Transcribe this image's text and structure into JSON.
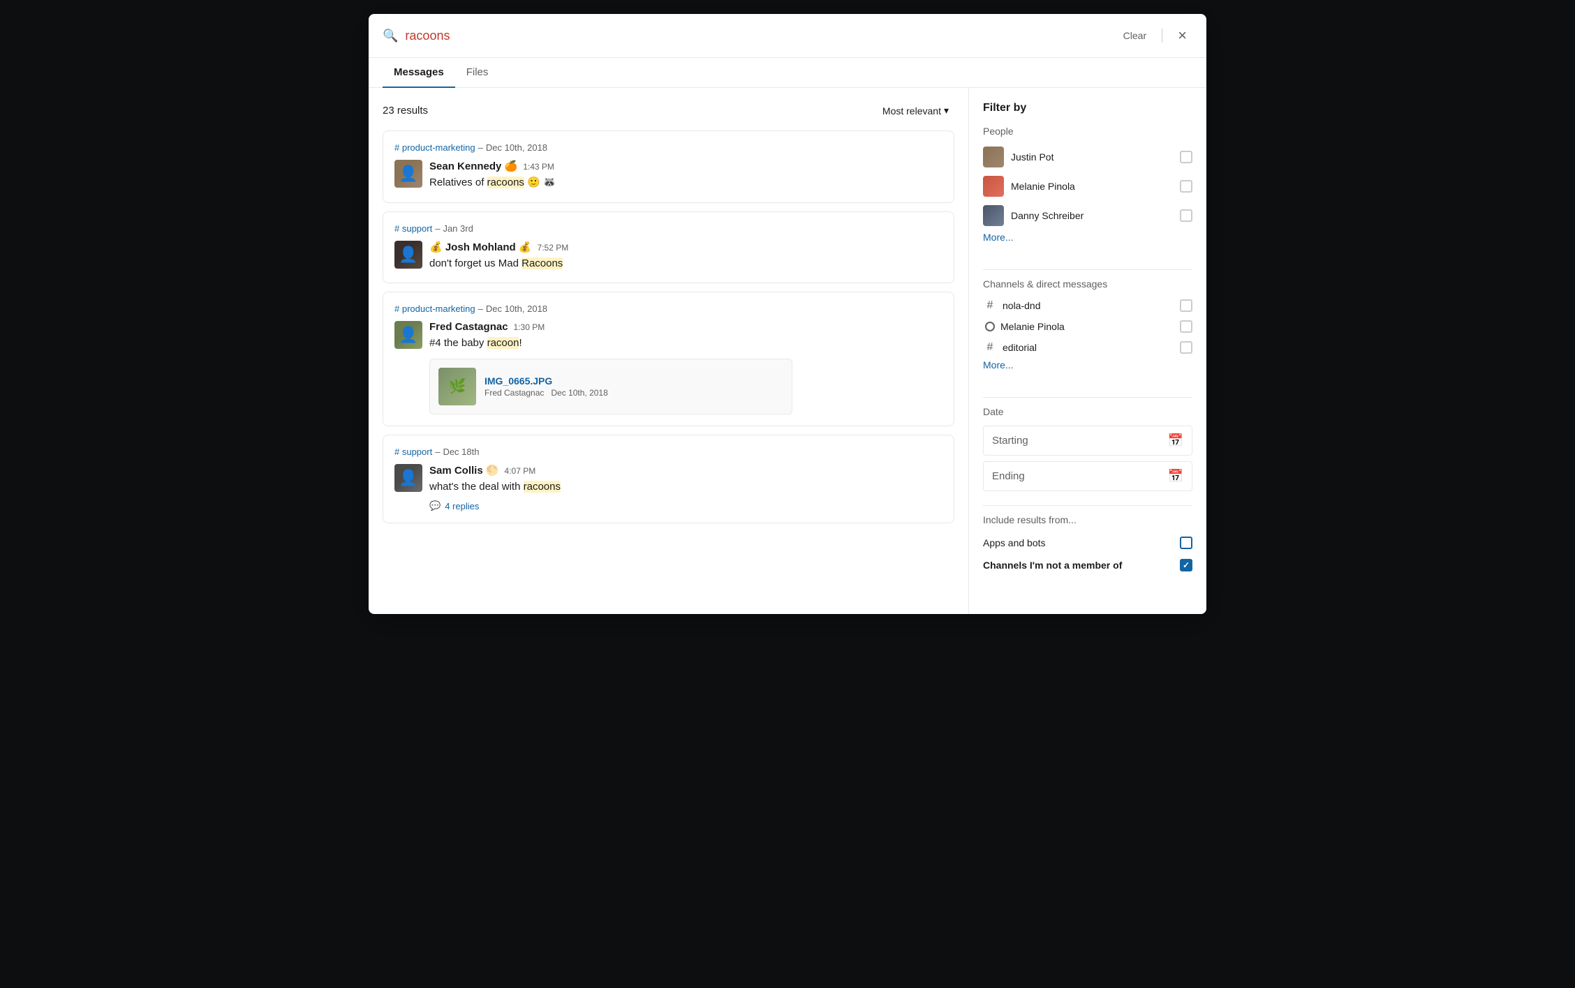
{
  "modal": {
    "search": {
      "query": "racoons",
      "clear_label": "Clear",
      "close_label": "×"
    },
    "tabs": [
      {
        "id": "messages",
        "label": "Messages",
        "active": true
      },
      {
        "id": "files",
        "label": "Files",
        "active": false
      }
    ],
    "results": {
      "count": "23 results",
      "sort_label": "Most relevant",
      "messages": [
        {
          "id": "msg1",
          "channel": "# product-marketing",
          "date": "Dec 10th, 2018",
          "author": "Sean Kennedy",
          "author_emoji": "🍊",
          "time": "1:43 PM",
          "text_parts": [
            {
              "type": "text",
              "content": "Relatives of "
            },
            {
              "type": "highlight",
              "content": "racoons"
            },
            {
              "type": "text",
              "content": " 🙂 🦝"
            }
          ],
          "avatar_class": "avatar-1",
          "avatar_emoji": "👤"
        },
        {
          "id": "msg2",
          "channel": "# support",
          "date": "Jan 3rd",
          "author": "Josh Mohland",
          "author_emoji": "💰",
          "time": "7:52 PM",
          "text_parts": [
            {
              "type": "text",
              "content": "don't forget us Mad "
            },
            {
              "type": "highlight",
              "content": "Racoons"
            }
          ],
          "avatar_class": "avatar-2",
          "avatar_emoji": "👤"
        },
        {
          "id": "msg3",
          "channel": "# product-marketing",
          "date": "Dec 10th, 2018",
          "author": "Fred Castagnac",
          "time": "1:30 PM",
          "text_parts": [
            {
              "type": "text",
              "content": "#4 the baby "
            },
            {
              "type": "highlight",
              "content": "racoon"
            },
            {
              "type": "text",
              "content": "!"
            }
          ],
          "avatar_class": "avatar-3",
          "avatar_emoji": "👤",
          "attachment": {
            "filename": "IMG_0665.JPG",
            "uploader": "Fred Castagnac",
            "upload_date": "Dec 10th, 2018"
          }
        },
        {
          "id": "msg4",
          "channel": "# support",
          "date": "Dec 18th",
          "author": "Sam Collis",
          "author_emoji": "🌕",
          "time": "4:07 PM",
          "text_parts": [
            {
              "type": "text",
              "content": "what's the deal with "
            },
            {
              "type": "highlight",
              "content": "racoons"
            }
          ],
          "avatar_class": "avatar-4",
          "avatar_emoji": "👤",
          "replies": "4 replies"
        }
      ]
    },
    "filter": {
      "title": "Filter by",
      "people_section": {
        "label": "People",
        "items": [
          {
            "name": "Justin Pot",
            "avatar_class": "pa-1",
            "checked": false
          },
          {
            "name": "Melanie Pinola",
            "avatar_class": "pa-2",
            "checked": false
          },
          {
            "name": "Danny Schreiber",
            "avatar_class": "pa-3",
            "checked": false
          }
        ],
        "more_label": "More..."
      },
      "channels_section": {
        "label": "Channels & direct messages",
        "items": [
          {
            "type": "hash",
            "name": "nola-dnd",
            "checked": false
          },
          {
            "type": "circle",
            "name": "Melanie Pinola",
            "checked": false
          },
          {
            "type": "hash",
            "name": "editorial",
            "checked": false
          }
        ],
        "more_label": "More..."
      },
      "date_section": {
        "label": "Date",
        "starting_label": "Starting",
        "ending_label": "Ending"
      },
      "include_section": {
        "label": "Include results from...",
        "items": [
          {
            "label": "Apps and bots",
            "bold": false,
            "checked": false
          },
          {
            "label": "Channels I'm not a member of",
            "bold": true,
            "checked": true
          }
        ]
      }
    }
  }
}
